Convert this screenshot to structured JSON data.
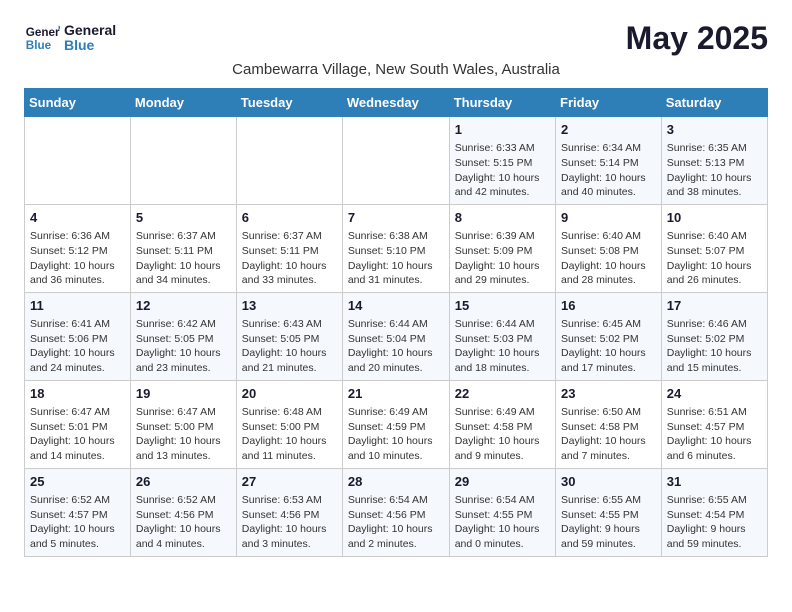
{
  "header": {
    "logo_line1": "General",
    "logo_line2": "Blue",
    "title": "May 2025",
    "subtitle": "Cambewarra Village, New South Wales, Australia"
  },
  "weekdays": [
    "Sunday",
    "Monday",
    "Tuesday",
    "Wednesday",
    "Thursday",
    "Friday",
    "Saturday"
  ],
  "weeks": [
    [
      {
        "day": "",
        "info": ""
      },
      {
        "day": "",
        "info": ""
      },
      {
        "day": "",
        "info": ""
      },
      {
        "day": "",
        "info": ""
      },
      {
        "day": "1",
        "info": "Sunrise: 6:33 AM\nSunset: 5:15 PM\nDaylight: 10 hours\nand 42 minutes."
      },
      {
        "day": "2",
        "info": "Sunrise: 6:34 AM\nSunset: 5:14 PM\nDaylight: 10 hours\nand 40 minutes."
      },
      {
        "day": "3",
        "info": "Sunrise: 6:35 AM\nSunset: 5:13 PM\nDaylight: 10 hours\nand 38 minutes."
      }
    ],
    [
      {
        "day": "4",
        "info": "Sunrise: 6:36 AM\nSunset: 5:12 PM\nDaylight: 10 hours\nand 36 minutes."
      },
      {
        "day": "5",
        "info": "Sunrise: 6:37 AM\nSunset: 5:11 PM\nDaylight: 10 hours\nand 34 minutes."
      },
      {
        "day": "6",
        "info": "Sunrise: 6:37 AM\nSunset: 5:11 PM\nDaylight: 10 hours\nand 33 minutes."
      },
      {
        "day": "7",
        "info": "Sunrise: 6:38 AM\nSunset: 5:10 PM\nDaylight: 10 hours\nand 31 minutes."
      },
      {
        "day": "8",
        "info": "Sunrise: 6:39 AM\nSunset: 5:09 PM\nDaylight: 10 hours\nand 29 minutes."
      },
      {
        "day": "9",
        "info": "Sunrise: 6:40 AM\nSunset: 5:08 PM\nDaylight: 10 hours\nand 28 minutes."
      },
      {
        "day": "10",
        "info": "Sunrise: 6:40 AM\nSunset: 5:07 PM\nDaylight: 10 hours\nand 26 minutes."
      }
    ],
    [
      {
        "day": "11",
        "info": "Sunrise: 6:41 AM\nSunset: 5:06 PM\nDaylight: 10 hours\nand 24 minutes."
      },
      {
        "day": "12",
        "info": "Sunrise: 6:42 AM\nSunset: 5:05 PM\nDaylight: 10 hours\nand 23 minutes."
      },
      {
        "day": "13",
        "info": "Sunrise: 6:43 AM\nSunset: 5:05 PM\nDaylight: 10 hours\nand 21 minutes."
      },
      {
        "day": "14",
        "info": "Sunrise: 6:44 AM\nSunset: 5:04 PM\nDaylight: 10 hours\nand 20 minutes."
      },
      {
        "day": "15",
        "info": "Sunrise: 6:44 AM\nSunset: 5:03 PM\nDaylight: 10 hours\nand 18 minutes."
      },
      {
        "day": "16",
        "info": "Sunrise: 6:45 AM\nSunset: 5:02 PM\nDaylight: 10 hours\nand 17 minutes."
      },
      {
        "day": "17",
        "info": "Sunrise: 6:46 AM\nSunset: 5:02 PM\nDaylight: 10 hours\nand 15 minutes."
      }
    ],
    [
      {
        "day": "18",
        "info": "Sunrise: 6:47 AM\nSunset: 5:01 PM\nDaylight: 10 hours\nand 14 minutes."
      },
      {
        "day": "19",
        "info": "Sunrise: 6:47 AM\nSunset: 5:00 PM\nDaylight: 10 hours\nand 13 minutes."
      },
      {
        "day": "20",
        "info": "Sunrise: 6:48 AM\nSunset: 5:00 PM\nDaylight: 10 hours\nand 11 minutes."
      },
      {
        "day": "21",
        "info": "Sunrise: 6:49 AM\nSunset: 4:59 PM\nDaylight: 10 hours\nand 10 minutes."
      },
      {
        "day": "22",
        "info": "Sunrise: 6:49 AM\nSunset: 4:58 PM\nDaylight: 10 hours\nand 9 minutes."
      },
      {
        "day": "23",
        "info": "Sunrise: 6:50 AM\nSunset: 4:58 PM\nDaylight: 10 hours\nand 7 minutes."
      },
      {
        "day": "24",
        "info": "Sunrise: 6:51 AM\nSunset: 4:57 PM\nDaylight: 10 hours\nand 6 minutes."
      }
    ],
    [
      {
        "day": "25",
        "info": "Sunrise: 6:52 AM\nSunset: 4:57 PM\nDaylight: 10 hours\nand 5 minutes."
      },
      {
        "day": "26",
        "info": "Sunrise: 6:52 AM\nSunset: 4:56 PM\nDaylight: 10 hours\nand 4 minutes."
      },
      {
        "day": "27",
        "info": "Sunrise: 6:53 AM\nSunset: 4:56 PM\nDaylight: 10 hours\nand 3 minutes."
      },
      {
        "day": "28",
        "info": "Sunrise: 6:54 AM\nSunset: 4:56 PM\nDaylight: 10 hours\nand 2 minutes."
      },
      {
        "day": "29",
        "info": "Sunrise: 6:54 AM\nSunset: 4:55 PM\nDaylight: 10 hours\nand 0 minutes."
      },
      {
        "day": "30",
        "info": "Sunrise: 6:55 AM\nSunset: 4:55 PM\nDaylight: 9 hours\nand 59 minutes."
      },
      {
        "day": "31",
        "info": "Sunrise: 6:55 AM\nSunset: 4:54 PM\nDaylight: 9 hours\nand 59 minutes."
      }
    ]
  ]
}
